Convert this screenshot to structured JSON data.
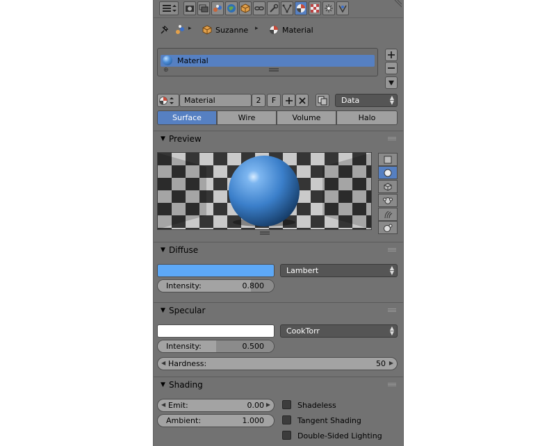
{
  "header": {
    "tab_icons": [
      "editor-type-icon",
      "render-icon",
      "render-layers-icon",
      "scene-icon",
      "world-icon",
      "object-icon",
      "constraints-icon",
      "modifiers-icon",
      "data-icon",
      "material-icon",
      "texture-icon",
      "particles-icon",
      "physics-icon"
    ],
    "active_tab": "material-icon"
  },
  "breadcrumb": {
    "object": "Suzanne",
    "material": "Material"
  },
  "material_slots": {
    "items": [
      {
        "label": "Material"
      }
    ]
  },
  "datablock": {
    "name": "Material",
    "users": "2",
    "fake_user": "F",
    "link": "Data"
  },
  "type_tabs": {
    "items": [
      "Surface",
      "Wire",
      "Volume",
      "Halo"
    ],
    "active": "Surface"
  },
  "preview": {
    "title": "Preview",
    "shapes": [
      "flat-plane-icon",
      "sphere-icon",
      "cube-icon",
      "monkey-icon",
      "hair-icon",
      "sphere-sky-icon"
    ],
    "active_shape": "sphere-icon"
  },
  "diffuse": {
    "title": "Diffuse",
    "color": "#5da8f6",
    "shader": "Lambert",
    "intensity_label": "Intensity:",
    "intensity_value": "0.800",
    "intensity_fraction": 0.8
  },
  "specular": {
    "title": "Specular",
    "color": "#ffffff",
    "shader": "CookTorr",
    "intensity_label": "Intensity:",
    "intensity_value": "0.500",
    "intensity_fraction": 0.5,
    "hardness_label": "Hardness:",
    "hardness_value": "50"
  },
  "shading": {
    "title": "Shading",
    "emit_label": "Emit:",
    "emit_value": "0.00",
    "ambient_label": "Ambient:",
    "ambient_value": "1.000",
    "shadeless_label": "Shadeless",
    "tangent_label": "Tangent Shading",
    "double_sided_label": "Double-Sided Lighting"
  },
  "colors": {
    "panel_bg": "#727272",
    "accent": "#5680c2",
    "dropdown_bg": "#555555"
  }
}
